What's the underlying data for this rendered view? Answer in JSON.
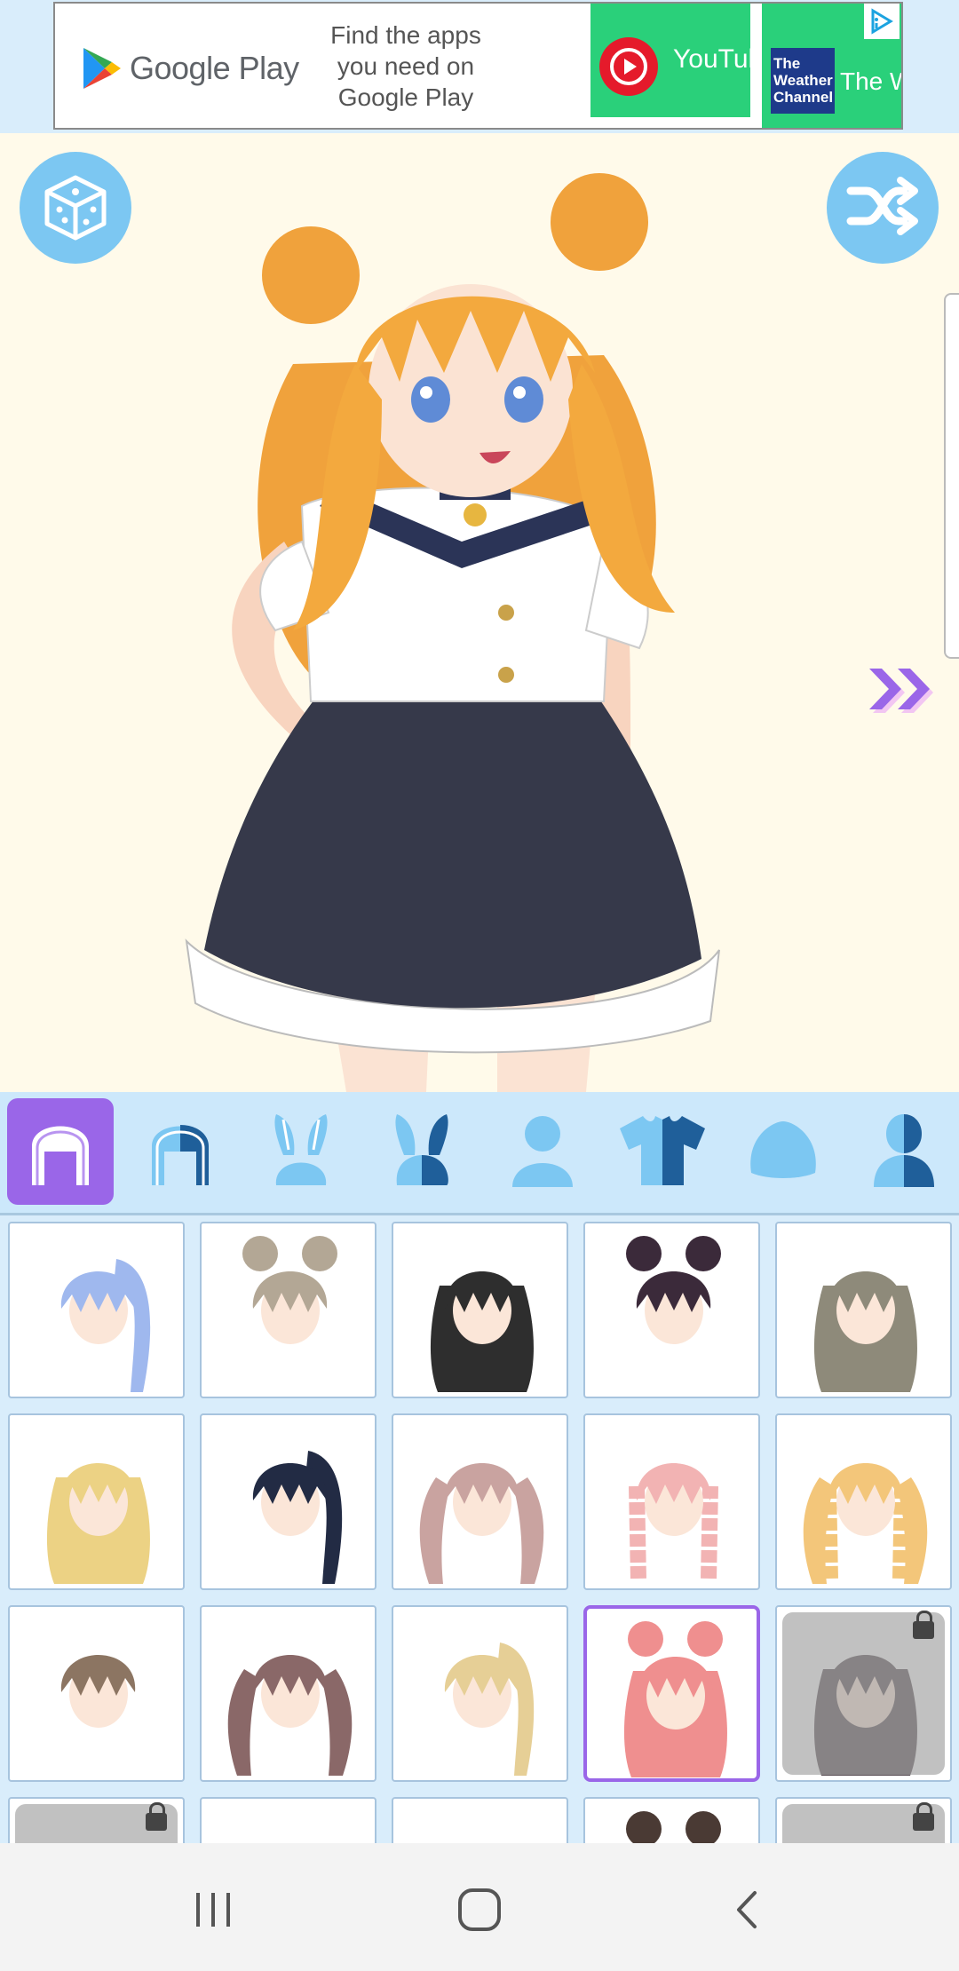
{
  "ad": {
    "store_name": "Google Play",
    "tagline": "Find the apps you need on Google Play",
    "tile1_label": "YouTul",
    "tile2_logo_text": "The Weather Channel",
    "tile2_label": "The W"
  },
  "colors": {
    "accent_blue": "#7cc7f2",
    "selected_purple": "#9a66e8",
    "category_bar_bg": "#cce8fb",
    "canvas_bg": "#fffaea"
  },
  "toolbar": {
    "random_icon": "dice-icon",
    "shuffle_icon": "shuffle-icon",
    "next_icon": "double-chevron-right-icon"
  },
  "categories": [
    {
      "icon": "hair-front-icon",
      "active": true
    },
    {
      "icon": "hair-back-icon",
      "active": false
    },
    {
      "icon": "ears-icon",
      "active": false
    },
    {
      "icon": "ears-alt-icon",
      "active": false
    },
    {
      "icon": "body-icon",
      "active": false
    },
    {
      "icon": "shirt-icon",
      "active": false
    },
    {
      "icon": "hat-icon",
      "active": false
    },
    {
      "icon": "body-alt-icon",
      "active": false
    }
  ],
  "hair_items": [
    {
      "color": "#9fb8ee",
      "style": "ponytail",
      "locked": false,
      "selected": false
    },
    {
      "color": "#b3a795",
      "style": "buns-short",
      "locked": false,
      "selected": false
    },
    {
      "color": "#2e2e2e",
      "style": "long-wavy",
      "locked": false,
      "selected": false
    },
    {
      "color": "#3b2a3a",
      "style": "messy-bun",
      "locked": false,
      "selected": false
    },
    {
      "color": "#8e8a7a",
      "style": "long-braids",
      "locked": false,
      "selected": false
    },
    {
      "color": "#ecd284",
      "style": "long-wavy",
      "locked": false,
      "selected": false
    },
    {
      "color": "#222b44",
      "style": "side-ponytail",
      "locked": false,
      "selected": false
    },
    {
      "color": "#c9a3a0",
      "style": "twin-curls",
      "locked": false,
      "selected": false
    },
    {
      "color": "#f2b3b3",
      "style": "crown-braid",
      "locked": false,
      "selected": false
    },
    {
      "color": "#f3c67a",
      "style": "twin-braids",
      "locked": false,
      "selected": false
    },
    {
      "color": "#8c7562",
      "style": "bob",
      "locked": false,
      "selected": false
    },
    {
      "color": "#8a6868",
      "style": "twin-tails",
      "locked": false,
      "selected": false
    },
    {
      "color": "#e6cf96",
      "style": "side-tail",
      "locked": false,
      "selected": false
    },
    {
      "color": "#ef8f8f",
      "style": "buns-wavy",
      "locked": false,
      "selected": true
    },
    {
      "color": "#5b4f55",
      "style": "long-curly",
      "locked": true,
      "selected": false
    },
    {
      "color": "#b7b0a8",
      "style": "long",
      "locked": true,
      "selected": false
    },
    {
      "color": "#3a2e2e",
      "style": "short",
      "locked": false,
      "selected": false
    },
    {
      "color": "#e89a4a",
      "style": "short",
      "locked": false,
      "selected": false
    },
    {
      "color": "#4a3a34",
      "style": "bun",
      "locked": false,
      "selected": false
    },
    {
      "color": "#5a4f54",
      "style": "twin-tails",
      "locked": true,
      "selected": false
    }
  ],
  "navbar": {
    "recents_icon": "recents-icon",
    "home_icon": "home-icon",
    "back_icon": "back-icon"
  }
}
